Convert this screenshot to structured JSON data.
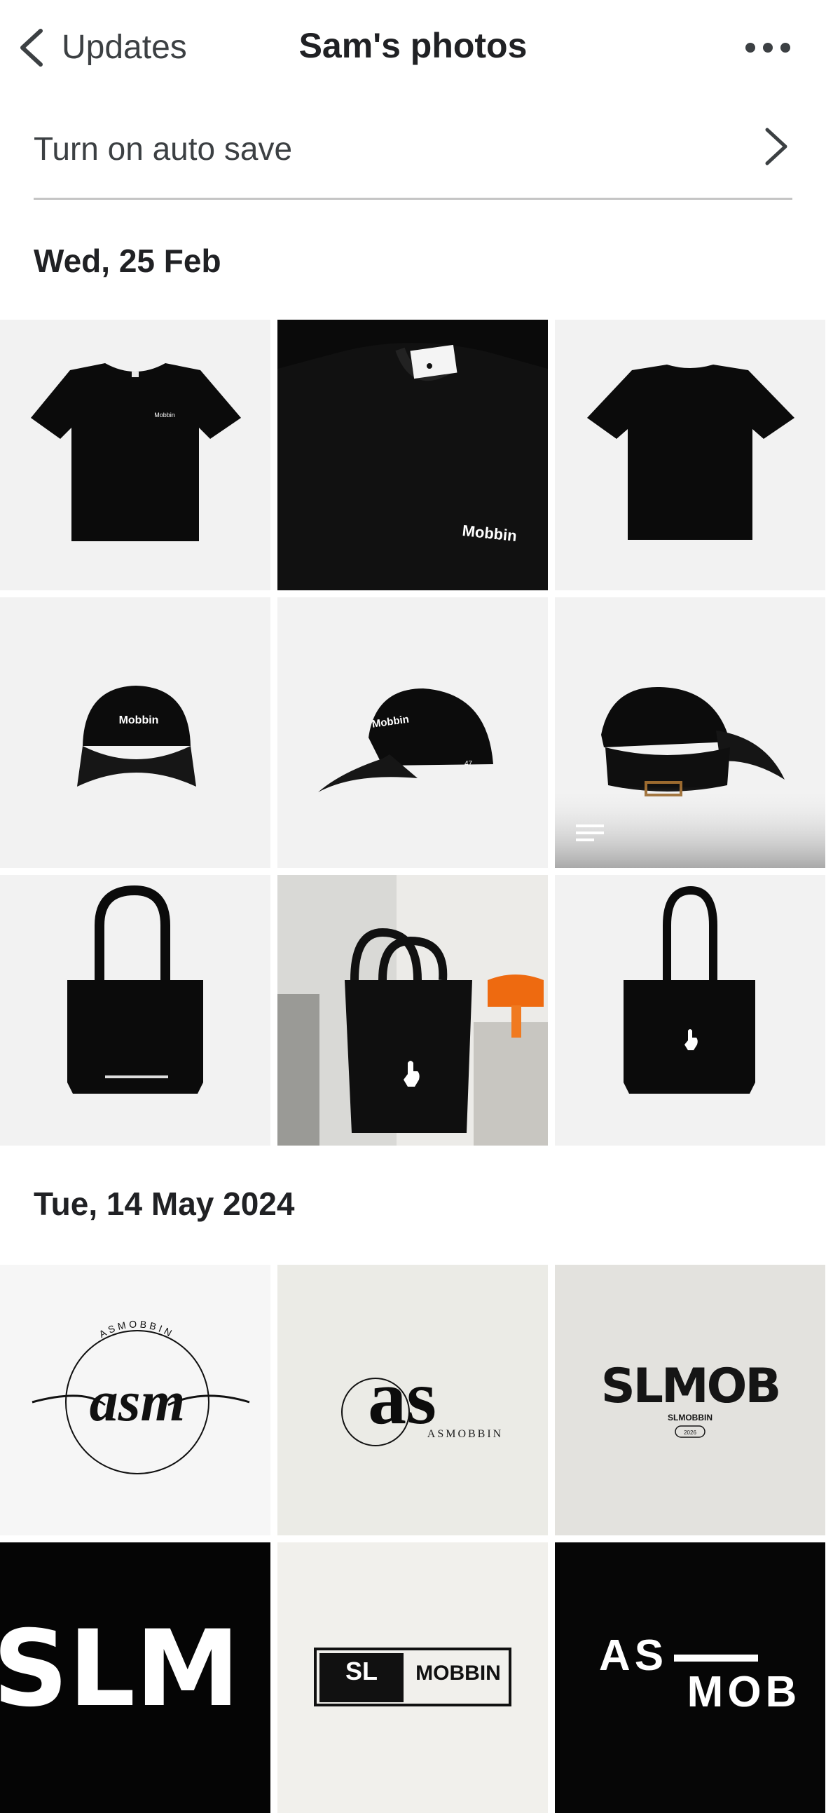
{
  "header": {
    "back_label": "Updates",
    "title": "Sam's photos"
  },
  "autosave": {
    "label": "Turn on auto save"
  },
  "sections": [
    {
      "date": "Wed, 25 Feb"
    },
    {
      "date": "Tue, 14 May 2024"
    }
  ],
  "tile_text": {
    "brand": "Mobbin",
    "asm_ring": "ASMOBBIN",
    "asm_script": "asm",
    "as_mark": "as",
    "as_sub": "ASMOBBIN",
    "slmob": "SLMOB",
    "slmobbin": "SLMOBBIN",
    "year": "2026",
    "slm_partial": "SLM",
    "sl_box": "SL",
    "mobbin_box": "MOBBIN",
    "as_partial": "AS",
    "mob_partial": "MOB"
  },
  "colors": {
    "text_primary": "#202124",
    "text_secondary": "#3c4043",
    "divider": "#c5c5c5",
    "tile_bg": "#f2f2f2"
  }
}
